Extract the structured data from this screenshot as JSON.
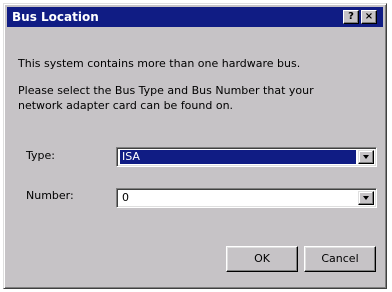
{
  "window": {
    "title": "Bus Location",
    "help_button": "?",
    "close_button": "×"
  },
  "body": {
    "line1": "This system contains more than one hardware bus.",
    "line2": "Please select the Bus Type and Bus Number that your",
    "line3": "network adapter card can be found on."
  },
  "type_field": {
    "label": "Type:",
    "value": "ISA"
  },
  "number_field": {
    "label": "Number:",
    "value": "0"
  },
  "buttons": {
    "ok": "OK",
    "cancel": "Cancel"
  },
  "colors": {
    "titlebar": "#101c84",
    "selection": "#101c84",
    "face": "#c6c3c6"
  }
}
